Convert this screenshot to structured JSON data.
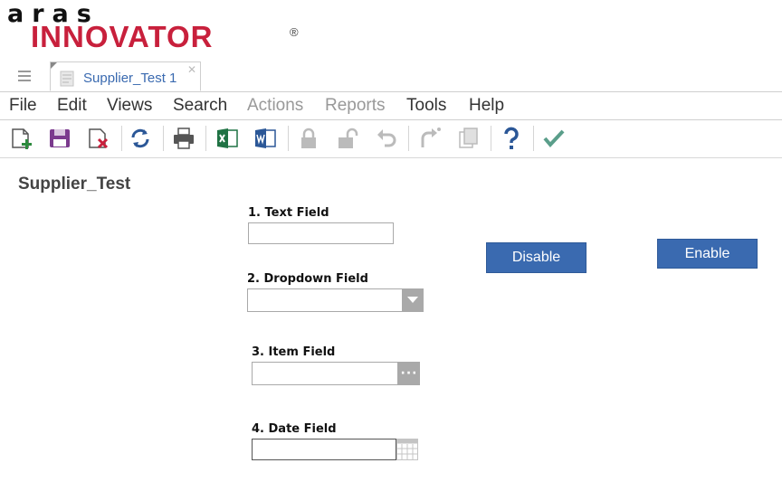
{
  "logo": {
    "top": "aras",
    "main": "INNOVATOR",
    "reg": "®"
  },
  "tab": {
    "label": "Supplier_Test 1",
    "close": "✕"
  },
  "menu": [
    "File",
    "Edit",
    "Views",
    "Search",
    "Actions",
    "Reports",
    "Tools",
    "Help"
  ],
  "menu_disabled": [
    "Actions",
    "Reports"
  ],
  "toolbar": [
    "new-item-icon",
    "save-icon",
    "discard-icon",
    "refresh-icon",
    "print-icon",
    "excel-export-icon",
    "word-export-icon",
    "lock-icon",
    "unlock-icon",
    "undo-icon",
    "promote-icon",
    "copy-icon",
    "help-icon",
    "done-icon"
  ],
  "colors": {
    "brand_red": "#c8203c",
    "accent_blue": "#3a6ab0",
    "save_purple": "#7b3a8e",
    "excel_green": "#1f7244",
    "word_blue": "#2b5797",
    "check_green": "#5a9e8a"
  },
  "form": {
    "title": "Supplier_Test",
    "text_field": {
      "label": "1. Text Field",
      "value": ""
    },
    "dropdown_field": {
      "label": "2. Dropdown Field",
      "value": ""
    },
    "item_field": {
      "label": "3. Item Field",
      "value": "",
      "button": "···"
    },
    "date_field": {
      "label": "4. Date Field",
      "value": ""
    },
    "disable_button": "Disable",
    "enable_button": "Enable"
  }
}
